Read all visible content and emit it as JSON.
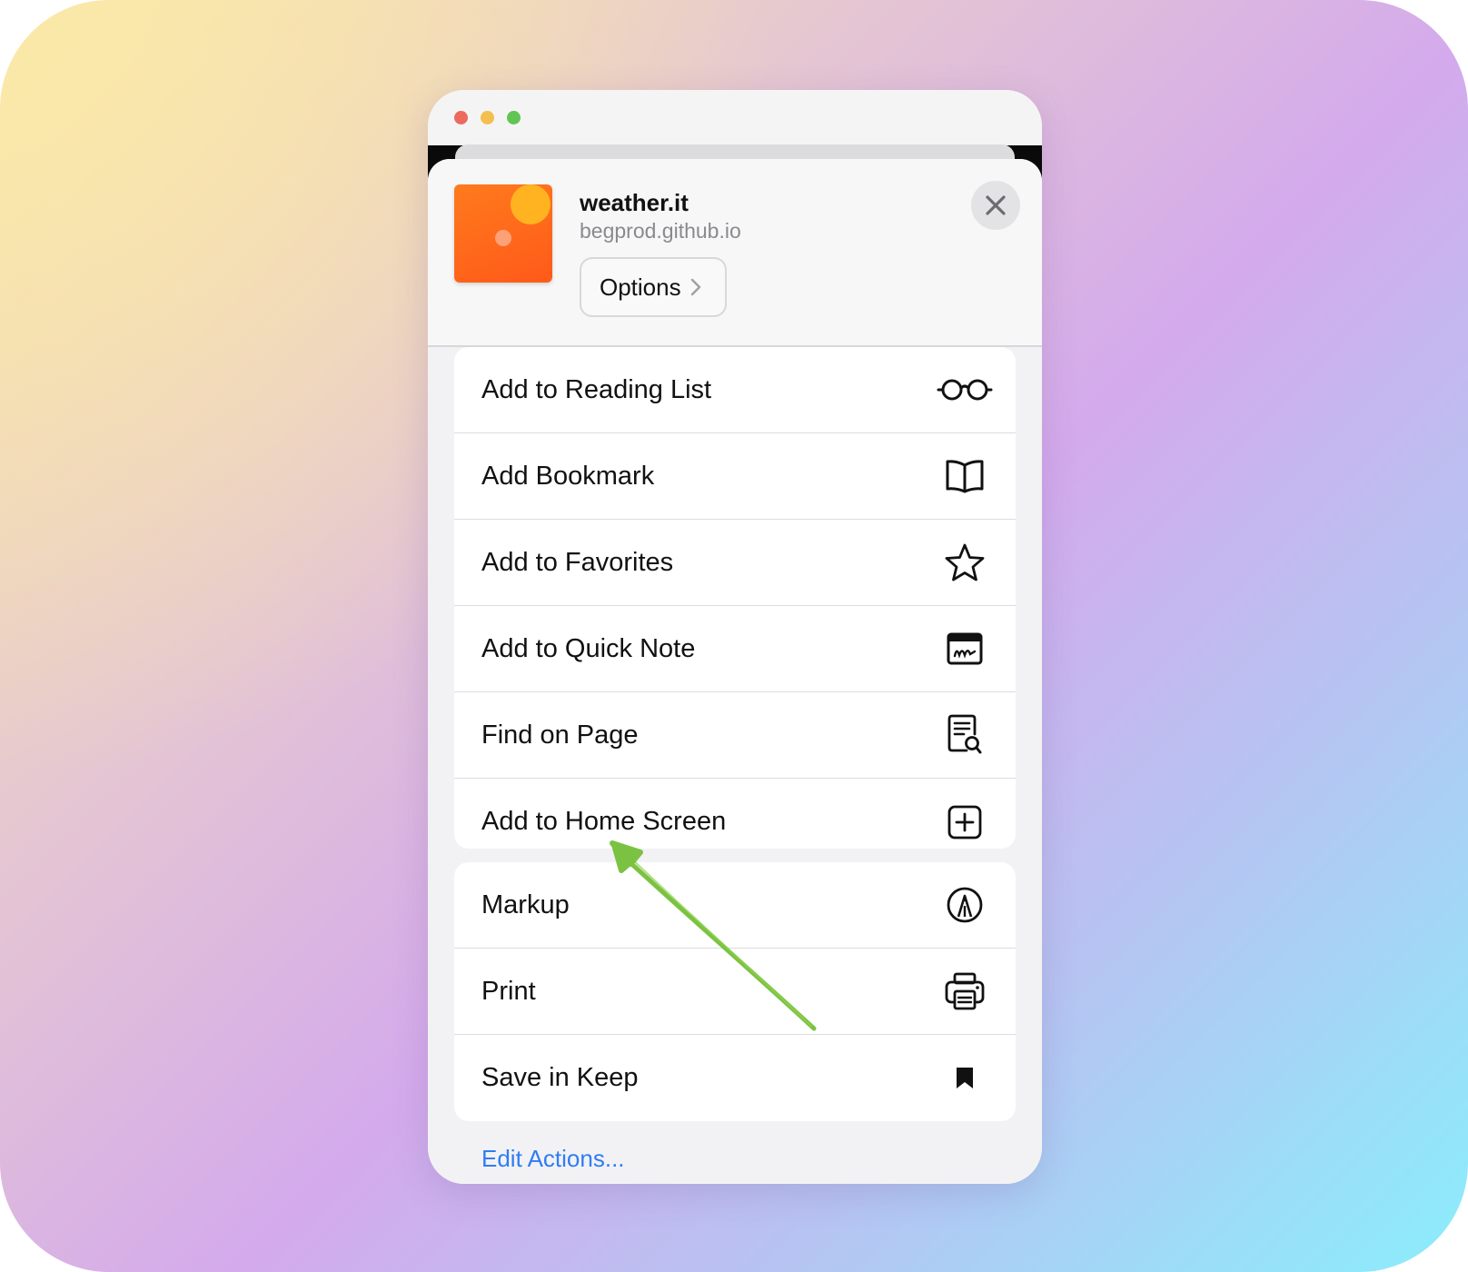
{
  "window": {
    "controls": [
      "close",
      "minimize",
      "zoom"
    ]
  },
  "share_sheet": {
    "site_title": "weather.it",
    "site_url": "begprod.github.io",
    "options_label": "Options",
    "close_icon": "close-icon"
  },
  "actions_group_1": [
    {
      "label": "Add to Reading List",
      "icon": "glasses-icon"
    },
    {
      "label": "Add Bookmark",
      "icon": "book-icon"
    },
    {
      "label": "Add to Favorites",
      "icon": "star-icon"
    },
    {
      "label": "Add to Quick Note",
      "icon": "quick-note-icon"
    },
    {
      "label": "Find on Page",
      "icon": "find-on-page-icon"
    },
    {
      "label": "Add to Home Screen",
      "icon": "plus-square-icon"
    }
  ],
  "actions_group_2": [
    {
      "label": "Markup",
      "icon": "markup-icon"
    },
    {
      "label": "Print",
      "icon": "printer-icon"
    },
    {
      "label": "Save in Keep",
      "icon": "bookmark-filled-icon"
    }
  ],
  "footer": {
    "edit_actions_label": "Edit Actions..."
  },
  "annotation": {
    "arrow_color": "#7cc242",
    "points_to": "Add to Home Screen"
  },
  "colors": {
    "accent_blue": "#2f7cf6",
    "thumb_orange": "#ff6a1a",
    "thumb_sun": "#ffb320"
  }
}
